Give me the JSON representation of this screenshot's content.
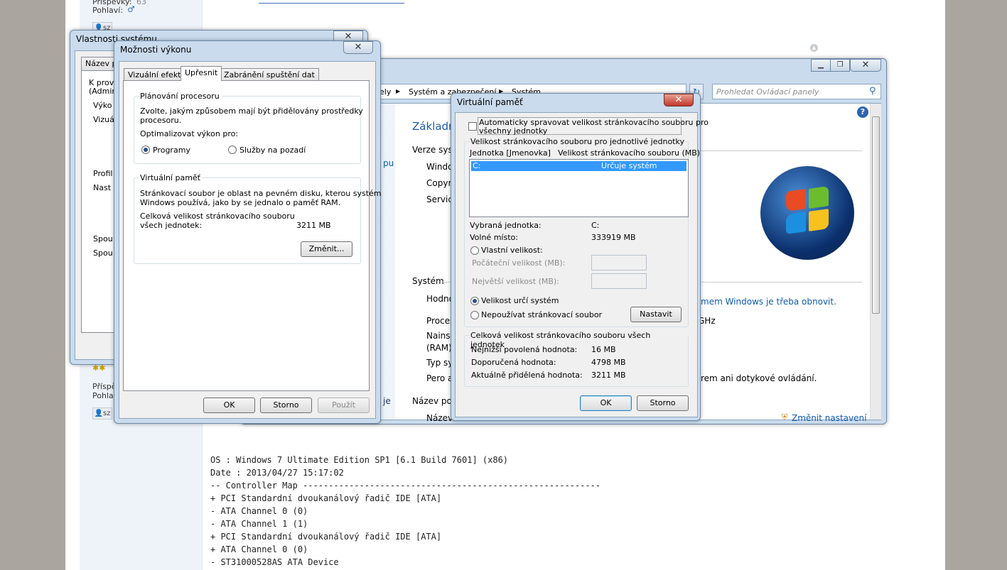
{
  "forum": {
    "top_label1": "Příspěvky:",
    "top_value1": "63",
    "top_label2": "Pohlaví:",
    "user_btn": "sz",
    "lower_label1": "Příspě",
    "lower_label2": "Pohla",
    "lower_user_btn": "sz",
    "code_lines": [
      "OS : Windows 7 Ultimate Edition SP1 [6.1 Build 7601] (x86)",
      "Date : 2013/04/27 15:17:02",
      "",
      "-- Controller Map ----------------------------------------------------------",
      "+ PCI Standardní dvoukanálový řadič IDE [ATA]",
      "- ATA Channel 0 (0)",
      "- ATA Channel 1 (1)",
      "+ PCI Standardní dvoukanálový řadič IDE [ATA]",
      "+ ATA Channel 0 (0)",
      "- ST31000528AS ATA Device"
    ]
  },
  "sysprops": {
    "title": "Vlastnosti systému",
    "tab_partial": "Název po",
    "lines": [
      "K prov",
      "(Admin",
      "Výko",
      "Vizuál",
      "Profil",
      "Nast",
      "Spou",
      "Spou"
    ]
  },
  "perf": {
    "title": "Možnosti výkonu",
    "tabs": [
      "Vizuální efekty",
      "Upřesnit",
      "Zabránění spuštění dat"
    ],
    "sched_group": "Plánování procesoru",
    "sched_text": [
      "Zvolte, jakým způsobem mají být přidělovány prostředky",
      "procesoru."
    ],
    "optimize_label": "Optimalizovat výkon pro:",
    "opt_programs": "Programy",
    "opt_services": "Služby na pozadí",
    "vm_group": "Virtuální paměť",
    "vm_text": [
      "Stránkovací soubor je oblast na pevném disku, kterou systém",
      "Windows používá, jako by se jednalo o paměť RAM."
    ],
    "total_label": [
      "Celková velikost stránkovacího souboru",
      "všech jednotek:"
    ],
    "total_value": "3211 MB",
    "change_btn": "Změnit...",
    "ok": "OK",
    "cancel": "Storno",
    "apply": "Použít"
  },
  "cp": {
    "breadcrumb_partial": "ely",
    "breadcrumb_sep": "▶",
    "crumb1": "Systém a zabezpečení",
    "crumb2": "Systém",
    "search_placeholder": "Prohledat Ovládací panely",
    "heading_partial": "Základn",
    "edition_partial": "Verze syst",
    "win_partial": "Windo",
    "copy_partial": "Copyr",
    "service_partial": "Servic",
    "link_partial": "pu",
    "system_section": "Systém",
    "rating_partial": "Hodno",
    "rating_link": "mem Windows je třeba obnovit.",
    "proc_partial": "Proces",
    "proc_value": "GHz",
    "ram_partial1": "Nainst",
    "ram_partial2": "(RAM):",
    "type_partial": "Typ sy",
    "pen_partial": "Pero a",
    "pen_value": "rem ani dotykové ovládání.",
    "name_section": "Název poč",
    "name_partial": "Název",
    "change_settings": "Změnit nastavení",
    "side_partial": "je"
  },
  "vm": {
    "title": "Virtuální paměť",
    "auto_label": [
      "Automaticky spravovat velikost stránkovacího souboru pro",
      "všechny jednotky"
    ],
    "per_drive_group": "Velikost stránkovacího souboru pro jednotlivé jednotky",
    "col1": "Jednotka [Jmenovka]",
    "col2": "Velikost stránkovacího souboru (MB)",
    "drive": "C:",
    "drive_size": "Určuje systém",
    "sel_drive_label": "Vybraná jednotka:",
    "sel_drive_value": "C:",
    "free_label": "Volné místo:",
    "free_value": "333919 MB",
    "custom_label": "Vlastní velikost:",
    "initial_label": "Počáteční velikost (MB):",
    "max_label": "Největší velikost (MB):",
    "system_managed": "Velikost určí systém",
    "no_paging": "Nepoužívat stránkovací soubor",
    "set_btn": "Nastavit",
    "total_group": "Celková velikost stránkovacího souboru všech jednotek",
    "min_label": "Nejnižší povolená hodnota:",
    "min_value": "16 MB",
    "rec_label": "Doporučená hodnota:",
    "rec_value": "4798 MB",
    "cur_label": "Aktuálně přidělená hodnota:",
    "cur_value": "3211 MB",
    "ok": "OK",
    "cancel": "Storno"
  }
}
